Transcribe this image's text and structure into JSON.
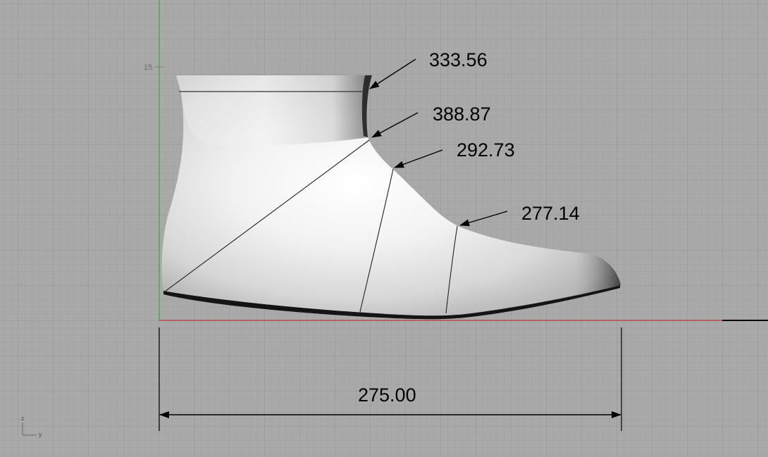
{
  "viewport": {
    "grid_tick_label": "15",
    "axis_indicator": {
      "z": "z",
      "y": "y"
    }
  },
  "dimensions": {
    "girth_labels": [
      "333.56",
      "388.87",
      "292.73",
      "277.14"
    ],
    "length_label": "275.00"
  },
  "colors": {
    "background": "#a9a9a9",
    "grid_minor": "#9b9b9b",
    "grid_major": "#8e8e8e",
    "x_axis": "#c03a3a",
    "y_axis": "#3bb33b"
  }
}
